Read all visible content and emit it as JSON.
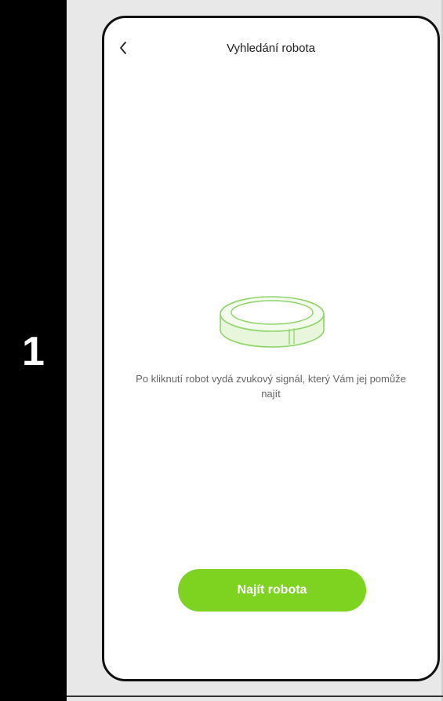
{
  "step": {
    "number": "1"
  },
  "header": {
    "title": "Vyhledání robota",
    "back_icon": "chevron-left-icon"
  },
  "main": {
    "illustration": "robot-vacuum-icon",
    "info_text": "Po kliknutí robot vydá zvukový signál, který Vám jej pomůže najít"
  },
  "actions": {
    "find_label": "Najít robota"
  },
  "colors": {
    "accent": "#7ed321",
    "illustration_stroke": "#8fd46a",
    "illustration_fill": "#e8f7dc",
    "step_bar": "#000000"
  }
}
